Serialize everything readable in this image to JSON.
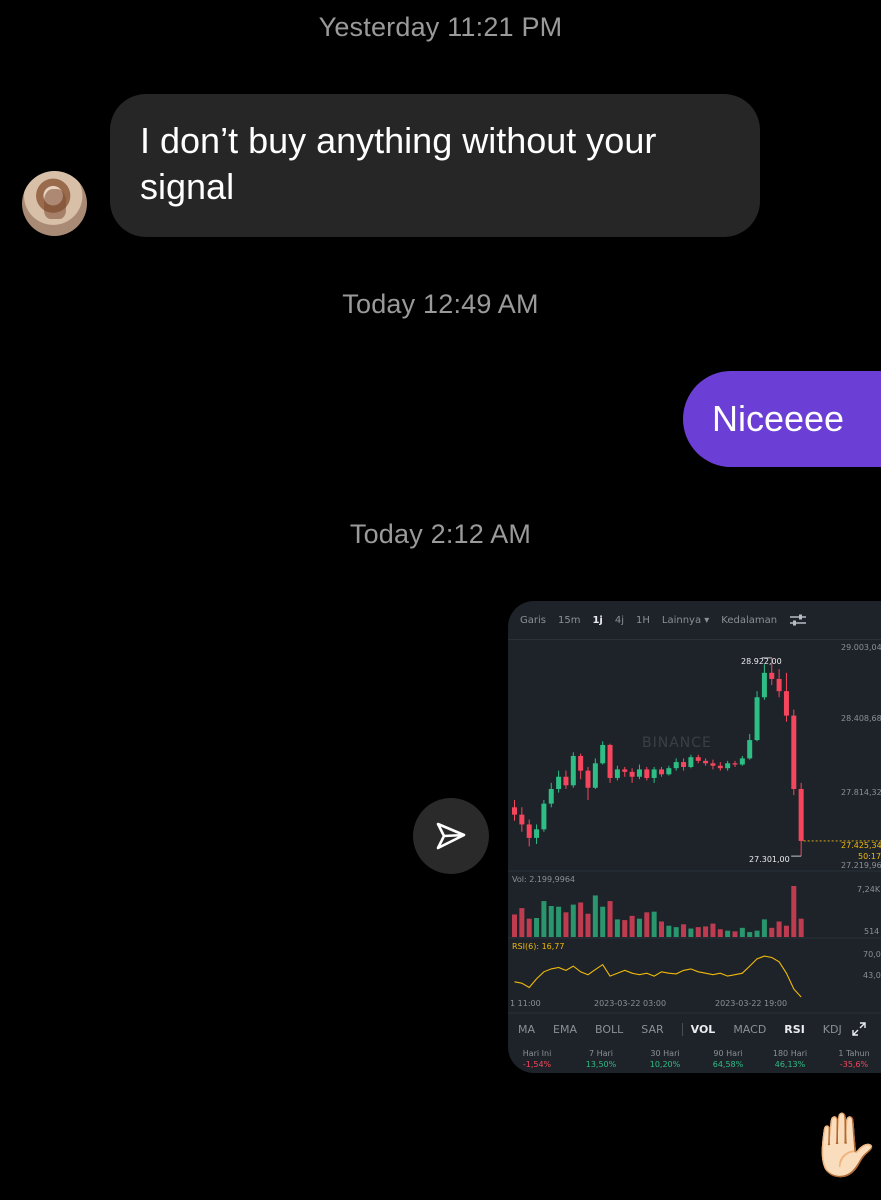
{
  "timestamps": {
    "t1": "Yesterday 11:21 PM",
    "t2": "Today 12:49 AM",
    "t3": "Today 2:12 AM"
  },
  "messages": {
    "incoming_1": "I don’t buy anything without your signal",
    "outgoing_1": "Niceeee"
  },
  "icons": {
    "avatar": "profile-photo",
    "share": "send-arrow-icon",
    "reaction": "raised-hand-emoji"
  },
  "colors": {
    "background": "#000000",
    "incoming_bubble": "#262626",
    "outgoing_bubble": "#6b3fd6",
    "timestamp": "#9a9a9a",
    "up": "#2ebd85",
    "down": "#f6465d",
    "rsi_line": "#f0b90b"
  },
  "reaction_emoji": "✋🏻",
  "screenshot": {
    "tabs": [
      "Garis",
      "15m",
      "1j",
      "4j",
      "1H",
      "Lainnya ▾",
      "Kedalaman"
    ],
    "active_tab": "1j",
    "price_axis": [
      "29.003,04",
      "28.408,68",
      "27.814,32",
      "27.425,34",
      "50:17",
      "27.219,96"
    ],
    "high_label": "28.922,00",
    "low_label": "27.301,00",
    "watermark": "BINANCE",
    "vol_label": "Vol: 2.199,9964",
    "vol_axis": [
      "7,24K",
      "514"
    ],
    "rsi_label": "RSI(6): 16,77",
    "rsi_axis": [
      "70,0",
      "43,0"
    ],
    "time_axis": [
      "1 11:00",
      "2023-03-22 03:00",
      "2023-03-22 19:00"
    ],
    "indicators": [
      "MA",
      "EMA",
      "BOLL",
      "SAR",
      "VOL",
      "MACD",
      "RSI",
      "KDJ"
    ],
    "active_indicators": [
      "VOL",
      "RSI"
    ],
    "performance": [
      {
        "label": "Hari Ini",
        "value": "-1,54%"
      },
      {
        "label": "7 Hari",
        "value": "13,50%"
      },
      {
        "label": "30 Hari",
        "value": "10,20%"
      },
      {
        "label": "90 Hari",
        "value": "64,58%"
      },
      {
        "label": "180 Hari",
        "value": "46,13%"
      },
      {
        "label": "1 Tahun",
        "value": "-35,6%"
      }
    ]
  },
  "chart_data": {
    "type": "candlestick",
    "ylim": [
      27219.96,
      29003.04
    ],
    "candles": [
      {
        "o": 27700,
        "c": 27640,
        "h": 27760,
        "l": 27590
      },
      {
        "o": 27640,
        "c": 27560,
        "h": 27700,
        "l": 27500
      },
      {
        "o": 27560,
        "c": 27450,
        "h": 27600,
        "l": 27380
      },
      {
        "o": 27450,
        "c": 27520,
        "h": 27560,
        "l": 27400
      },
      {
        "o": 27520,
        "c": 27730,
        "h": 27760,
        "l": 27500
      },
      {
        "o": 27730,
        "c": 27850,
        "h": 27900,
        "l": 27700
      },
      {
        "o": 27850,
        "c": 27950,
        "h": 28000,
        "l": 27820
      },
      {
        "o": 27950,
        "c": 27880,
        "h": 28000,
        "l": 27850
      },
      {
        "o": 27880,
        "c": 28120,
        "h": 28150,
        "l": 27860
      },
      {
        "o": 28120,
        "c": 28000,
        "h": 28140,
        "l": 27930
      },
      {
        "o": 28000,
        "c": 27860,
        "h": 28030,
        "l": 27760
      },
      {
        "o": 27860,
        "c": 28060,
        "h": 28100,
        "l": 27850
      },
      {
        "o": 28060,
        "c": 28210,
        "h": 28240,
        "l": 28050
      },
      {
        "o": 28210,
        "c": 27940,
        "h": 28220,
        "l": 27900
      },
      {
        "o": 27940,
        "c": 28010,
        "h": 28040,
        "l": 27920
      },
      {
        "o": 28010,
        "c": 27990,
        "h": 28030,
        "l": 27950
      },
      {
        "o": 27990,
        "c": 27950,
        "h": 28020,
        "l": 27900
      },
      {
        "o": 27950,
        "c": 28010,
        "h": 28050,
        "l": 27930
      },
      {
        "o": 28010,
        "c": 27940,
        "h": 28030,
        "l": 27920
      },
      {
        "o": 27940,
        "c": 28010,
        "h": 28030,
        "l": 27900
      },
      {
        "o": 28010,
        "c": 27970,
        "h": 28030,
        "l": 27950
      },
      {
        "o": 27970,
        "c": 28020,
        "h": 28040,
        "l": 27960
      },
      {
        "o": 28020,
        "c": 28070,
        "h": 28100,
        "l": 28000
      },
      {
        "o": 28070,
        "c": 28030,
        "h": 28100,
        "l": 28000
      },
      {
        "o": 28030,
        "c": 28110,
        "h": 28130,
        "l": 28020
      },
      {
        "o": 28110,
        "c": 28080,
        "h": 28130,
        "l": 28060
      },
      {
        "o": 28080,
        "c": 28060,
        "h": 28100,
        "l": 28040
      },
      {
        "o": 28060,
        "c": 28040,
        "h": 28090,
        "l": 28010
      },
      {
        "o": 28040,
        "c": 28020,
        "h": 28070,
        "l": 28000
      },
      {
        "o": 28020,
        "c": 28060,
        "h": 28080,
        "l": 28000
      },
      {
        "o": 28060,
        "c": 28050,
        "h": 28080,
        "l": 28030
      },
      {
        "o": 28050,
        "c": 28100,
        "h": 28120,
        "l": 28040
      },
      {
        "o": 28100,
        "c": 28250,
        "h": 28300,
        "l": 28090
      },
      {
        "o": 28250,
        "c": 28600,
        "h": 28650,
        "l": 28240
      },
      {
        "o": 28600,
        "c": 28800,
        "h": 28870,
        "l": 28580
      },
      {
        "o": 28800,
        "c": 28750,
        "h": 28922,
        "l": 28700
      },
      {
        "o": 28750,
        "c": 28650,
        "h": 28830,
        "l": 28600
      },
      {
        "o": 28650,
        "c": 28450,
        "h": 28800,
        "l": 28400
      },
      {
        "o": 28450,
        "c": 27850,
        "h": 28500,
        "l": 27800
      },
      {
        "o": 27850,
        "c": 27425,
        "h": 27900,
        "l": 27301
      }
    ],
    "volume_max": 7240,
    "volume": [
      3200,
      4100,
      2600,
      2700,
      5100,
      4400,
      4300,
      3500,
      4600,
      4900,
      3300,
      5900,
      4300,
      5100,
      2500,
      2400,
      3000,
      2600,
      3500,
      3600,
      2200,
      1600,
      1400,
      1800,
      1200,
      1400,
      1500,
      1900,
      1100,
      900,
      800,
      1300,
      700,
      900,
      2500,
      1300,
      2200,
      1600,
      7240,
      2600
    ],
    "rsi": [
      38,
      36,
      30,
      42,
      52,
      56,
      58,
      54,
      60,
      52,
      48,
      55,
      62,
      46,
      50,
      54,
      50,
      48,
      50,
      46,
      52,
      50,
      49,
      54,
      56,
      52,
      50,
      48,
      50,
      46,
      48,
      50,
      60,
      70,
      74,
      72,
      66,
      50,
      28,
      16.77
    ]
  }
}
